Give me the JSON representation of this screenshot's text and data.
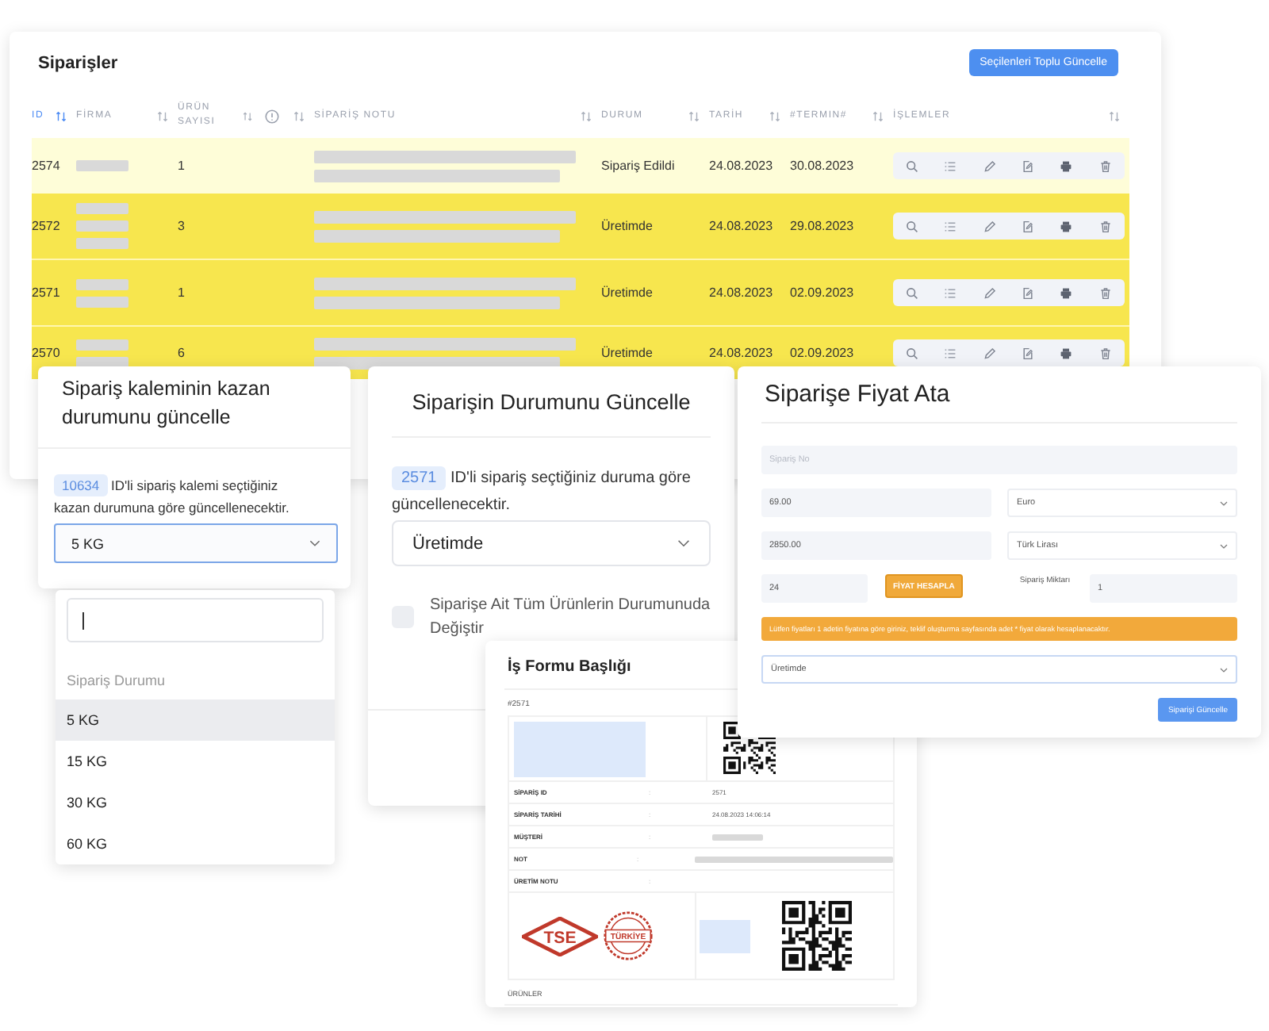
{
  "orders_table": {
    "title": "Siparişler",
    "bulk_update_button": "Seçilenleri Toplu Güncelle",
    "columns": [
      {
        "kind": "text",
        "label": "ID",
        "sorted": true
      },
      {
        "kind": "text",
        "label": "FİRMA",
        "sorted": false
      },
      {
        "kind": "text",
        "label": "ÜRÜN SAYISI",
        "sorted": false
      },
      {
        "kind": "icon",
        "sorted": false
      },
      {
        "kind": "text",
        "label": "SİPARİŞ NOTU",
        "sorted": false
      },
      {
        "kind": "text",
        "label": "DURUM",
        "sorted": false
      },
      {
        "kind": "text",
        "label": "TARİH",
        "sorted": false
      },
      {
        "kind": "text",
        "label": "#TERMIN#",
        "sorted": false
      },
      {
        "kind": "text",
        "label": "İŞLEMLER",
        "sorted": false
      }
    ],
    "rows": [
      {
        "id": "2574",
        "product_count": "1",
        "status": "Sipariş Edildi",
        "date": "24.08.2023",
        "due_date": "30.08.2023",
        "color": "#fefdd8"
      },
      {
        "id": "2572",
        "product_count": "3",
        "status": "Üretimde",
        "date": "24.08.2023",
        "due_date": "29.08.2023",
        "color": "#f7e64e"
      },
      {
        "id": "2571",
        "product_count": "1",
        "status": "Üretimde",
        "date": "24.08.2023",
        "due_date": "02.09.2023",
        "color": "#f7e64e"
      },
      {
        "id": "2570",
        "product_count": "6",
        "status": "Üretimde",
        "date": "24.08.2023",
        "due_date": "02.09.2023",
        "color": "#f7e64e"
      }
    ]
  },
  "item_status_modal": {
    "title": "Sipariş kaleminin kazan durumunu güncelle",
    "badge": "10634",
    "message": "ID'li sipariş kalemi seçtiğiniz kazan durumuna göre güncellenecektir.",
    "select": {
      "value": "5 KG",
      "expanded": true
    },
    "dropdown": {
      "group_label": "Sipariş Durumu",
      "options": [
        {
          "label": "5 KG",
          "selected": true
        },
        {
          "label": "15 KG",
          "selected": false
        },
        {
          "label": "30 KG",
          "selected": false
        },
        {
          "label": "60 KG",
          "selected": false
        }
      ]
    }
  },
  "order_status_modal": {
    "title": "Siparişin Durumunu Güncelle",
    "badge": "2571",
    "message": "ID'li sipariş seçtiğiniz duruma göre güncellenecektir.",
    "select": {
      "value": "Üretimde"
    },
    "checkbox": {
      "label": "Siparişe Ait Tüm Ürünlerin Durumunuda Değiştir",
      "checked": false
    }
  },
  "price_modal": {
    "title": "Siparişe Fiyat Ata",
    "order_no": {
      "placeholder": "Sipariş No"
    },
    "price_rows": [
      {
        "value": "69.00",
        "currency": "Euro"
      },
      {
        "value": "2850.00",
        "currency": "Türk Lirası"
      }
    ],
    "rate": {
      "value": "24"
    },
    "calculate_button": "FİYAT HESAPLA",
    "quantity": {
      "label": "Sipariş Miktarı",
      "value": "1"
    },
    "alert": "Lütfen fiyatları 1 adetin fiyatına göre giriniz, teklif oluşturma sayfasında adet * fiyat olarak hesaplanacaktır.",
    "status_select": {
      "value": "Üretimde"
    },
    "submit_button": "Siparişi Güncelle"
  },
  "work_form": {
    "title": "İş Formu Başlığı",
    "number": "#2571",
    "rows": [
      {
        "label": "SİPARİŞ ID",
        "separator": ":",
        "kind": "text",
        "value": "2571"
      },
      {
        "label": "SİPARİŞ TARİHİ",
        "separator": ":",
        "kind": "text",
        "value": "24.08.2023 14:06:14"
      },
      {
        "label": "MÜŞTERİ",
        "separator": ":",
        "kind": "redacted"
      },
      {
        "label": "NOT",
        "separator": ":",
        "kind": "redacted-long"
      },
      {
        "label": "ÜRETİM NOTU",
        "separator": ":",
        "kind": "empty"
      }
    ],
    "logos": [
      {
        "kind": "diamond",
        "text": "TSE"
      },
      {
        "kind": "seal",
        "text": "TÜRKİYE"
      }
    ],
    "products_label": "ÜRÜNLER"
  }
}
